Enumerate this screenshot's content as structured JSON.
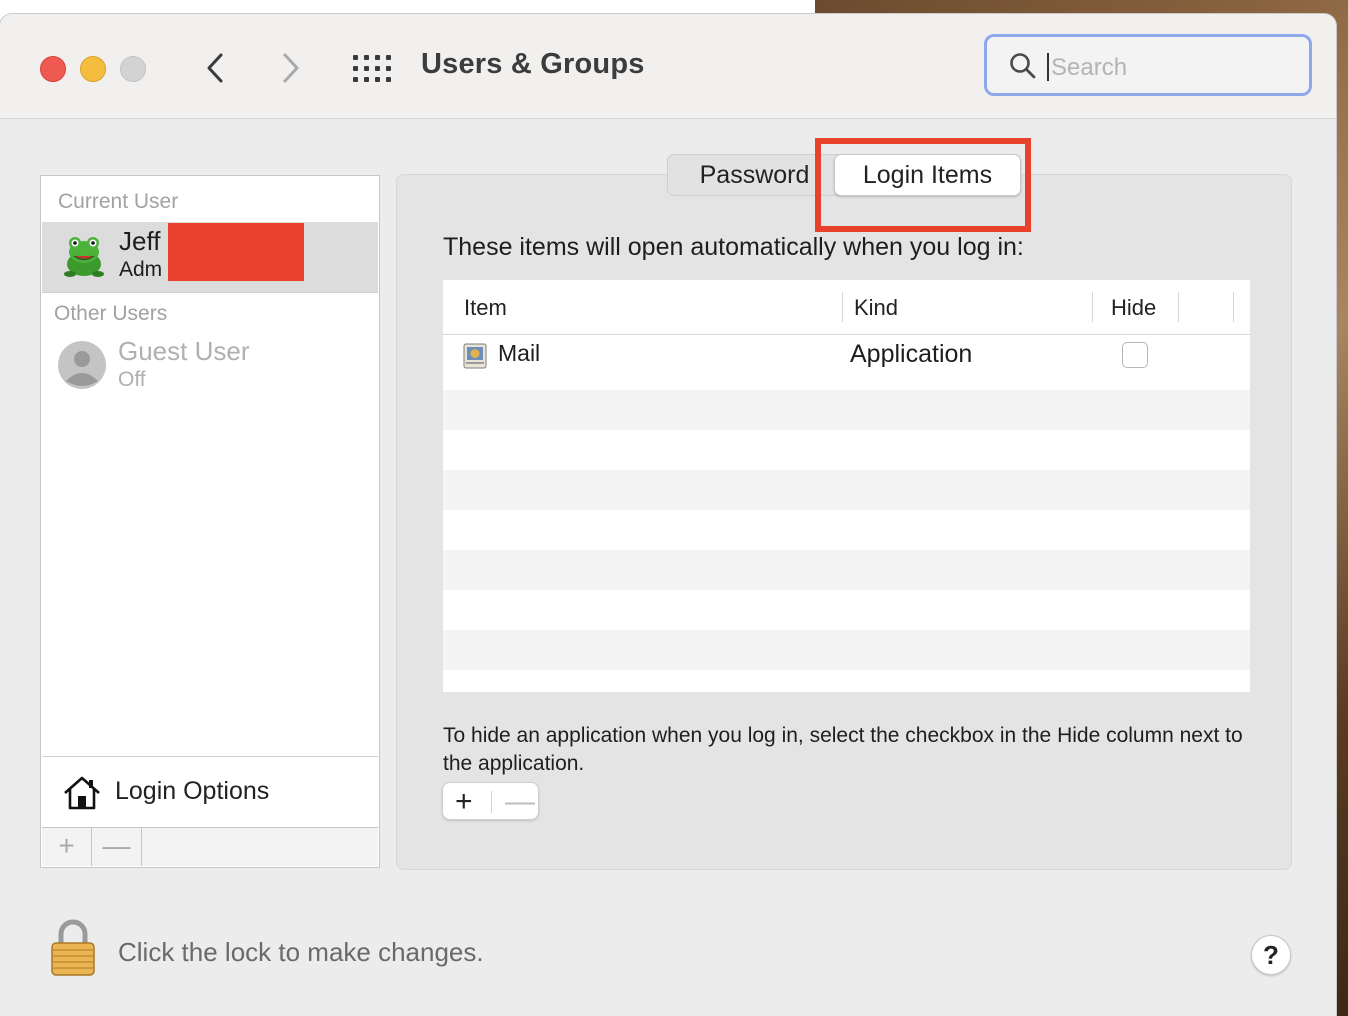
{
  "window": {
    "title": "Users & Groups"
  },
  "search": {
    "placeholder": "Search"
  },
  "sidebar": {
    "current_user_header": "Current User",
    "current_user": {
      "name": "Jeff",
      "role": "Adm"
    },
    "other_users_header": "Other Users",
    "guest": {
      "name": "Guest User",
      "status": "Off"
    },
    "login_options": "Login Options",
    "add_symbol": "+",
    "remove_symbol": "—"
  },
  "tabs": [
    {
      "label": "Password",
      "selected": false
    },
    {
      "label": "Login Items",
      "selected": true
    }
  ],
  "login_items": {
    "intro": "These items will open automatically when you log in:",
    "columns": {
      "item": "Item",
      "kind": "Kind",
      "hide": "Hide"
    },
    "rows": [
      {
        "item": "Mail",
        "kind": "Application",
        "hide": false,
        "icon": "mail-app-icon"
      }
    ],
    "hint": "To hide an application when you log in, select the checkbox in the Hide column next to the application.",
    "add_symbol": "+",
    "remove_symbol": "—"
  },
  "footer": {
    "lock_text": "Click the lock to make changes.",
    "help_label": "?"
  },
  "colors": {
    "highlight": "#e8412c",
    "redaction": "#e8412c",
    "search_focus": "#8fa8ec"
  }
}
